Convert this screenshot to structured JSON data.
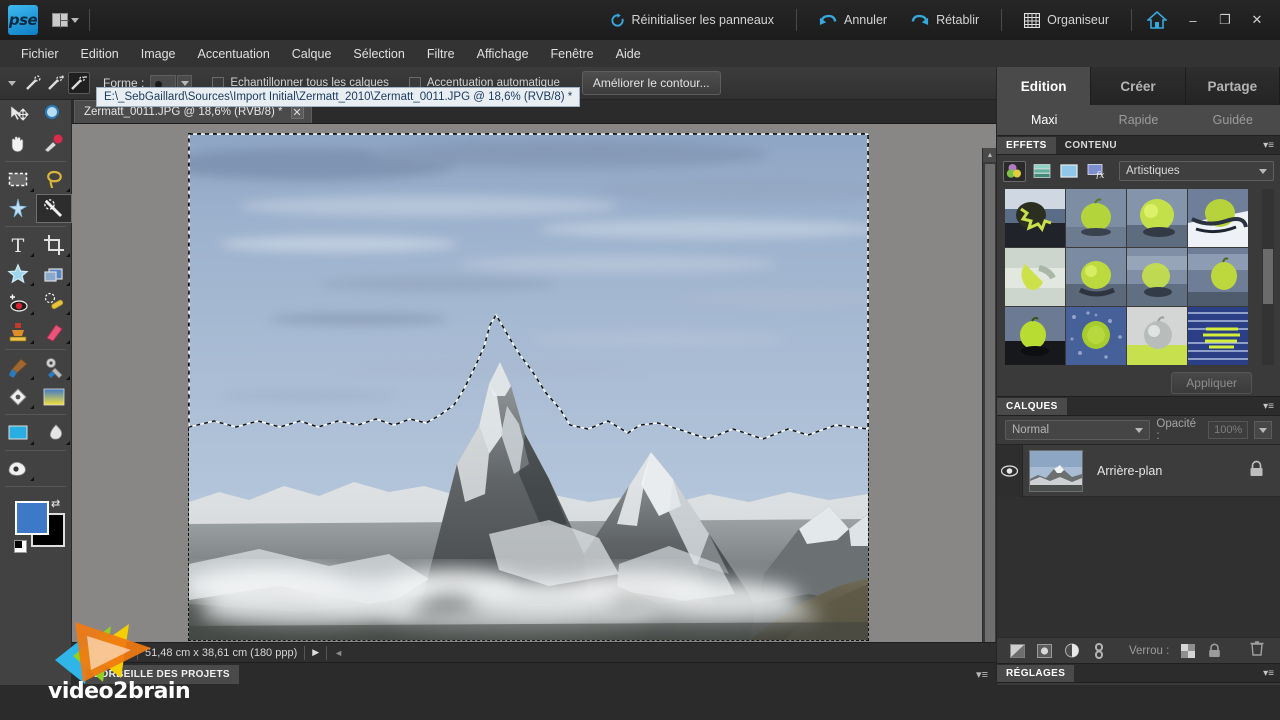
{
  "app": {
    "logo_text": "pse",
    "title": "Adobe Photoshop Elements"
  },
  "titlebar": {
    "layout_icon": "layout-grid-icon",
    "actions": [
      {
        "label": "Réinitialiser les panneaux",
        "icon": "reset-icon",
        "name": "reset-panels-button"
      },
      {
        "label": "Annuler",
        "icon": "undo-arrow-icon",
        "name": "undo-button"
      },
      {
        "label": "Rétablir",
        "icon": "redo-arrow-icon",
        "name": "redo-button"
      },
      {
        "label": "Organiseur",
        "icon": "grid-organizer-icon",
        "name": "organizer-button"
      }
    ],
    "home_icon": "home-house-icon",
    "minimize": "–",
    "restore": "❐",
    "close": "✕"
  },
  "menubar": {
    "items": [
      "Fichier",
      "Edition",
      "Image",
      "Accentuation",
      "Calque",
      "Sélection",
      "Filtre",
      "Affichage",
      "Fenêtre",
      "Aide"
    ]
  },
  "optionsbar": {
    "form_label": "Forme :",
    "checkbox1": "Echantillonner tous les calques",
    "checkbox2": "Accentuation automatique",
    "refine_button": "Améliorer le contour...",
    "tool_modes": [
      "wand-new-icon",
      "wand-add-icon",
      "wand-subtract-icon"
    ],
    "selected_mode_index": 2
  },
  "tooltip": {
    "text": "E:\\_SebGaillard\\Sources\\Import Initial\\Zermatt_2010\\Zermatt_0011.JPG @ 18,6% (RVB/8) *"
  },
  "toolbox": {
    "groups": [
      [
        "move-icon",
        "zoom-magnifier-icon",
        "hand-icon",
        "eyedropper-icon"
      ],
      [
        "rectangular-marquee-icon",
        "lasso-icon",
        "magic-wand-icon",
        "quick-selection-icon"
      ],
      [
        "type-text-icon",
        "crop-icon",
        "cookie-cutter-icon",
        "straighten-icon",
        "red-eye-icon",
        "healing-brush-icon",
        "clone-stamp-icon",
        "eraser-icon"
      ],
      [
        "brush-icon",
        "smart-brush-icon",
        "paint-bucket-icon",
        "gradient-icon"
      ],
      [
        "shape-rectangle-icon",
        "blur-icon"
      ],
      [
        "sponge-icon"
      ]
    ],
    "selected_tool": "quick-selection-icon",
    "foreground_color": "#3e79c8",
    "background_color": "#000000",
    "swap_icon": "swap-colors-icon",
    "default_icon": "default-colors-icon"
  },
  "document": {
    "tab_label": "Zermatt_0011.JPG @ 18,6% (RVB/8) *",
    "tab_close": "✕",
    "image_subject": "Matterhorn mountain panorama with clouds",
    "has_selection": true
  },
  "statusbar": {
    "zoom": "18,6%",
    "dimensions": "51,48 cm x 38,61 cm (180 ppp)",
    "play_icon": "play-triangle-icon",
    "prev_icon": "left-arrow-icon"
  },
  "projectbin": {
    "label": "CORBEILLE DES PROJETS",
    "menu_icon": "panel-menu-icon"
  },
  "rightpanel": {
    "main_tabs": [
      {
        "label": "Edition",
        "active": true
      },
      {
        "label": "Créer",
        "active": false
      },
      {
        "label": "Partage",
        "active": false
      }
    ],
    "sub_tabs": [
      {
        "label": "Maxi",
        "active": true
      },
      {
        "label": "Rapide",
        "active": false
      },
      {
        "label": "Guidée",
        "active": false
      }
    ],
    "effects_panel": {
      "tabs": [
        {
          "label": "EFFETS",
          "active": true
        },
        {
          "label": "CONTENU",
          "active": false
        }
      ],
      "menu_icon": "panel-menu-icon",
      "category_icons": [
        "filters-icon",
        "layer-styles-icon",
        "photo-effects-icon",
        "fx-icon"
      ],
      "selected_category_index": 0,
      "dropdown_value": "Artistiques",
      "thumbnail_count": 12,
      "apply_button": "Appliquer"
    },
    "layers_panel": {
      "title": "CALQUES",
      "menu_icon": "panel-menu-icon",
      "blend_mode": "Normal",
      "opacity_label": "Opacité :",
      "opacity_value": "100%",
      "layers": [
        {
          "name": "Arrière-plan",
          "visible": true,
          "locked": true,
          "thumb": "mountain-thumbnail"
        }
      ],
      "tools": [
        "new-layer-icon",
        "adjustment-layer-icon",
        "fill-layer-icon",
        "link-layers-icon"
      ],
      "lock_label": "Verrou :",
      "lock_transparency_icon": "checker-lock-icon",
      "lock_all_icon": "padlock-icon",
      "delete_icon": "trash-icon"
    },
    "adjustments_panel": {
      "title": "RÉGLAGES",
      "menu_icon": "panel-menu-icon"
    }
  },
  "watermark": {
    "text": "video2brain",
    "colors": [
      "#2fb5e8",
      "#8fd321",
      "#f5d000",
      "#f07a12"
    ]
  }
}
